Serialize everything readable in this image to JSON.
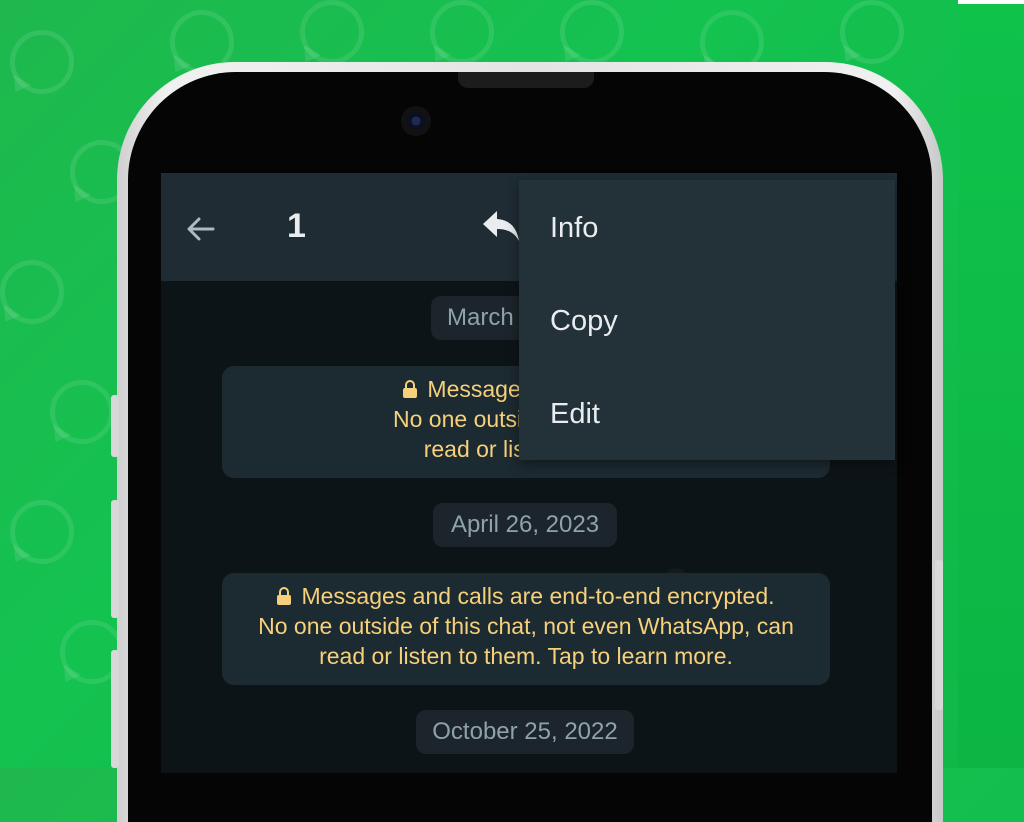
{
  "header": {
    "selected_count": "1"
  },
  "menu": {
    "items": [
      {
        "label": "Info"
      },
      {
        "label": "Copy"
      },
      {
        "label": "Edit"
      }
    ]
  },
  "chat": {
    "date_1": "March",
    "encryption_partial": {
      "line1": "Messages and calls a",
      "line2": "No one outside of this cha",
      "line3": "read or listen to ther"
    },
    "date_2": "April 26, 2023",
    "encryption_full": {
      "line1": "Messages and calls are end-to-end encrypted.",
      "line2": "No one outside of this chat, not even WhatsApp, can",
      "line3": "read or listen to them. Tap to learn more."
    },
    "date_3": "October 25, 2022"
  },
  "colors": {
    "background_green": "#14c250",
    "header": "#1f2c34",
    "menu": "#233138",
    "encryption_text": "#f6d07a"
  }
}
